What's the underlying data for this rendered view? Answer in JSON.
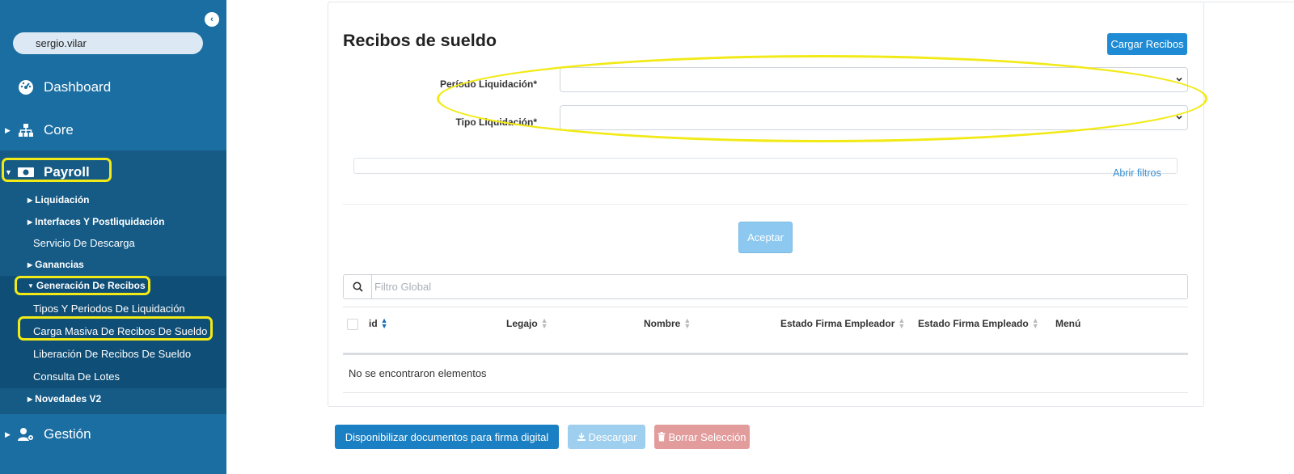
{
  "sidebar": {
    "user": "sergio.vilar",
    "items": {
      "dashboard": "Dashboard",
      "core": "Core",
      "payroll": "Payroll",
      "gestion": "Gestión"
    },
    "payroll_sub": {
      "liquidacion": "Liquidación",
      "interfaces": "Interfaces Y Postliquidación",
      "servicio": "Servicio De Descarga",
      "ganancias": "Ganancias",
      "generacion": "Generación De Recibos",
      "tipos": "Tipos Y Periodos De Liquidación",
      "carga_masiva": "Carga Masiva De Recibos De Sueldo",
      "liberacion": "Liberación De Recibos De Sueldo",
      "consulta": "Consulta De Lotes",
      "novedades": "Novedades V2"
    },
    "colors": {
      "background": "#1b6ea1",
      "highlight": "#f2ea16"
    }
  },
  "main": {
    "title": "Recibos de sueldo",
    "cargar_button": "Cargar Recibos",
    "form": {
      "periodo_label": "Período Liquidación*",
      "tipo_label": "Tipo Liquidación*",
      "periodo_value": "",
      "tipo_value": ""
    },
    "abrir_filtros": "Abrir filtros",
    "aceptar_button": "Aceptar",
    "search": {
      "placeholder": "Filtro Global",
      "value": ""
    },
    "table": {
      "columns": [
        "id",
        "Legajo",
        "Nombre",
        "Estado Firma Empleador",
        "Estado Firma Empleado",
        "Menú"
      ],
      "empty_message": "No se encontraron elementos"
    },
    "buttons": {
      "disponibilizar": "Disponibilizar documentos para firma digital",
      "descargar": "Descargar",
      "borrar": "Borrar Selección"
    },
    "colors": {
      "primary": "#1e8bd4",
      "danger": "#e39c9c"
    }
  }
}
